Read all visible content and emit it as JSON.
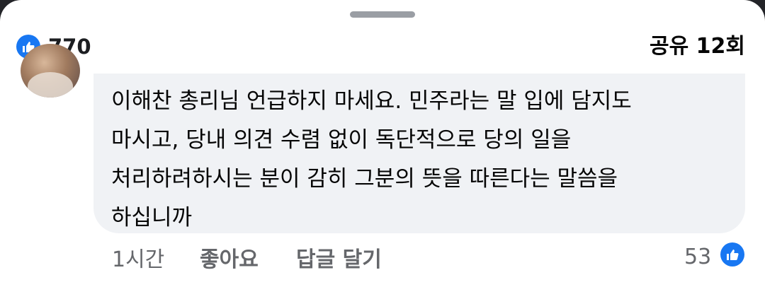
{
  "header": {
    "reaction_count": "770",
    "share_count": "공유 12회"
  },
  "comment": {
    "text": "이해찬 총리님 언급하지 마세요. 민주라는 말 입에 담지도\n마시고, 당내 의견 수렴 없이 독단적으로 당의 일을\n처리하려하시는 분이 감히 그분의 뜻을 따른다는 말씀을\n하십니까",
    "timestamp": "1시간",
    "like_label": "좋아요",
    "reply_label": "답글 달기",
    "like_count": "53"
  },
  "icons": {
    "header_reaction": "like-icon",
    "comment_reaction": "like-icon",
    "avatar": "avatar-photo"
  },
  "colors": {
    "accent": "#1877f2",
    "bubble": "#f0f2f5",
    "secondary_text": "#65676b"
  }
}
